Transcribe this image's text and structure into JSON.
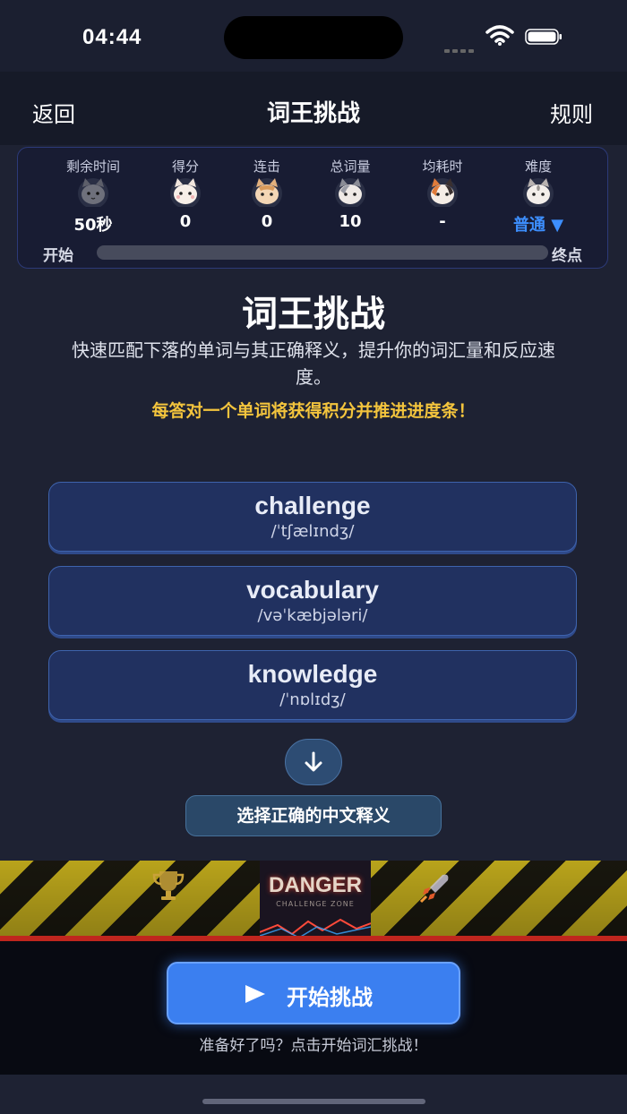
{
  "status": {
    "time": "04:44"
  },
  "nav": {
    "back": "返回",
    "title": "词王挑战",
    "rules": "规则"
  },
  "stats": [
    {
      "label": "剩余时间",
      "value": "50秒",
      "cat": "gray"
    },
    {
      "label": "得分",
      "value": "0",
      "cat": "white"
    },
    {
      "label": "连击",
      "value": "0",
      "cat": "orange"
    },
    {
      "label": "总词量",
      "value": "10",
      "cat": "gray-white"
    },
    {
      "label": "均耗时",
      "value": "-",
      "cat": "calico"
    },
    {
      "label": "难度",
      "value": "普通 ▼",
      "cat": "white-gray"
    }
  ],
  "progress": {
    "start": "开始",
    "end": "终点",
    "fraction": 0
  },
  "hero": {
    "title": "词王挑战",
    "desc": "快速匹配下落的单词与其正确释义，提升你的词汇量和反应速度。",
    "note": "每答对一个单词将获得积分并推进进度条！"
  },
  "words": [
    {
      "word": "challenge",
      "phonetic": "/ˈtʃælɪndʒ/"
    },
    {
      "word": "vocabulary",
      "phonetic": "/vəˈkæbjələri/"
    },
    {
      "word": "knowledge",
      "phonetic": "/ˈnɒlɪdʒ/"
    }
  ],
  "controls": {
    "down_icon": "arrow-down-icon",
    "select_label": "选择正确的中文释义"
  },
  "banner": {
    "title": "DANGER",
    "subtitle": "CHALLENGE ZONE"
  },
  "start": {
    "label": "开始挑战",
    "hint": "准备好了吗？点击开始词汇挑战！"
  },
  "colors": {
    "accent": "#3b7ff0",
    "note": "#f3c43d",
    "bg": "#1e2233"
  }
}
